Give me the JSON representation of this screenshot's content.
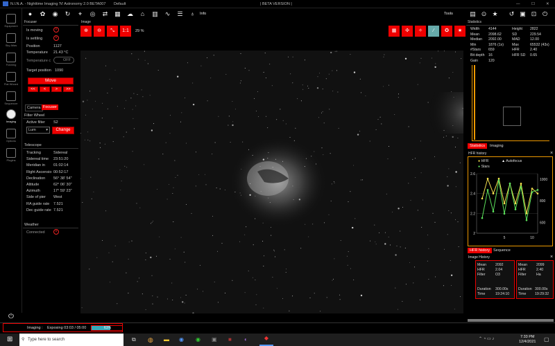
{
  "app": {
    "title": "N.I.N.A. - Nighttime Imaging 'N' Astronomy 2.0 BETA007",
    "profile": "Default",
    "beta": "| BETA VERSION |",
    "info": "Info",
    "tools": "Tools"
  },
  "nav": [
    {
      "label": "Equipment",
      "icon": "telescope-icon"
    },
    {
      "label": "Sky Atlas",
      "icon": "atlas-icon"
    },
    {
      "label": "Framing",
      "icon": "framing-icon"
    },
    {
      "label": "Flat Wizard",
      "icon": "flat-icon"
    },
    {
      "label": "Sequencer",
      "icon": "sequence-icon"
    },
    {
      "label": "Imaging",
      "icon": "imaging-icon"
    },
    {
      "label": "Options",
      "icon": "gear-icon"
    },
    {
      "label": "Plugins",
      "icon": "puzzle-icon"
    }
  ],
  "focuser": {
    "title": "Focuser",
    "is_moving_label": "Is moving",
    "is_settling_label": "Is settling",
    "position_label": "Position",
    "position": "1127",
    "temperature_label": "Temperature",
    "temperature": "21.43 °C",
    "temp_comp_label": "Temperature c",
    "temp_comp_state": "OFF",
    "target_label": "Target position",
    "target": "1090",
    "move": "Move",
    "steps": [
      "<<",
      "<",
      ">",
      ">>"
    ],
    "tabs": [
      "Camera",
      "Focuser"
    ]
  },
  "filter_wheel": {
    "title": "Filter Wheel",
    "active_label": "Active filter",
    "active": "S2",
    "selected": "Lum",
    "change": "Change"
  },
  "telescope": {
    "title": "Telescope",
    "rows": [
      [
        "Tracking",
        "Sidereal"
      ],
      [
        "Sidereal time",
        "23:51:20"
      ],
      [
        "Meridian in",
        "01:02:14"
      ],
      [
        "Right Ascensio",
        "00:52:17"
      ],
      [
        "Declination",
        "56° 38' 54\""
      ],
      [
        "Altitude",
        "62° 06' 30\""
      ],
      [
        "Azimuth",
        "17° 59' 23\""
      ],
      [
        "Side of pier",
        "West"
      ],
      [
        "RA guide rate",
        "7.521"
      ],
      [
        "Dec guide rate",
        "7.521"
      ]
    ]
  },
  "weather": {
    "title": "Weather",
    "connected_label": "Connected"
  },
  "image": {
    "title": "Image",
    "zoom_btn": "1:1",
    "zoom": "29 %"
  },
  "statistics": {
    "title": "Statistics",
    "left": [
      [
        "Width",
        "4144"
      ],
      [
        "Mean",
        "2098.62"
      ],
      [
        "Median",
        "2092.00"
      ],
      [
        "Min",
        "1876 (1x)"
      ],
      [
        "#Stars",
        "659"
      ],
      [
        "Bit depth",
        "16"
      ],
      [
        "Gain",
        "120"
      ]
    ],
    "right": [
      [
        "Height",
        "2822"
      ],
      [
        "SD",
        "229.54"
      ],
      [
        "MAD",
        "12.00"
      ],
      [
        "Max",
        "65532 (43x)"
      ],
      [
        "HFR",
        "2.40"
      ],
      [
        "HFR SD",
        "0.65"
      ]
    ],
    "tabs": [
      "Statistics",
      "Imaging"
    ]
  },
  "hfr_history": {
    "title": "HFR history",
    "legend": [
      "HFR",
      "Autofocus",
      "Stars"
    ],
    "tabs": [
      "HFR history",
      "Sequence"
    ]
  },
  "chart_data": {
    "type": "line",
    "title": "HFR history",
    "x": [
      1,
      2,
      3,
      4,
      5,
      6,
      7,
      8,
      9,
      10,
      11
    ],
    "series": [
      {
        "name": "HFR",
        "values": [
          2.35,
          2.55,
          2.4,
          2.55,
          2.3,
          2.5,
          2.3,
          2.5,
          2.2,
          2.45,
          2.4
        ],
        "color": "#f4e04d"
      },
      {
        "name": "Stars",
        "values": [
          640,
          900,
          700,
          990,
          680,
          960,
          720,
          930,
          620,
          880,
          900
        ],
        "color": "#5be05b"
      }
    ],
    "xlim": [
      0,
      11
    ],
    "ylim": [
      2,
      2.6
    ],
    "y2lim": [
      500,
      1050
    ],
    "xticks": [
      "5",
      "10"
    ],
    "yticks": [
      "2",
      "2.2",
      "2.4",
      "2.6"
    ],
    "y2ticks": [
      "600",
      "800",
      "1000"
    ]
  },
  "image_history": {
    "title": "Image History",
    "cards": [
      {
        "mean": "2092",
        "hfr": "2.04",
        "filter": "O3",
        "duration": "300.00s",
        "time": "19:24:10"
      },
      {
        "mean": "2099",
        "hfr": "2.40",
        "filter": "Ha",
        "duration": "300.00s",
        "time": "19:29:32"
      }
    ],
    "labels": {
      "mean": "Mean",
      "hfr": "HFR",
      "filter": "Filter",
      "duration": "Duration",
      "time": "Time"
    }
  },
  "status": {
    "label": "Imaging",
    "text": "Exposing 03:03 / 05:00",
    "progress": 0.61,
    "progress_text": "61%"
  },
  "taskbar": {
    "search": "Type here to search",
    "time": "7:33 PM",
    "date": "12/4/2021"
  }
}
